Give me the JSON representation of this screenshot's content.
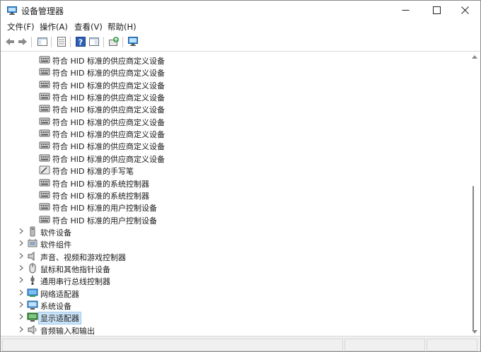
{
  "window": {
    "title": "设备管理器"
  },
  "menu": {
    "items": [
      "文件(F)",
      "操作(A)",
      "查看(V)",
      "帮助(H)"
    ]
  },
  "tree": {
    "children": [
      "符合 HID 标准的供应商定义设备",
      "符合 HID 标准的供应商定义设备",
      "符合 HID 标准的供应商定义设备",
      "符合 HID 标准的供应商定义设备",
      "符合 HID 标准的供应商定义设备",
      "符合 HID 标准的供应商定义设备",
      "符合 HID 标准的供应商定义设备",
      "符合 HID 标准的供应商定义设备",
      "符合 HID 标准的供应商定义设备",
      "符合 HID 标准的手写笔",
      "符合 HID 标准的系统控制器",
      "符合 HID 标准的系统控制器",
      "符合 HID 标准的用户控制设备",
      "符合 HID 标准的用户控制设备"
    ],
    "categories": [
      "软件设备",
      "软件组件",
      "声音、视频和游戏控制器",
      "鼠标和其他指针设备",
      "通用串行总线控制器",
      "网络适配器",
      "系统设备",
      "显示适配器",
      "音频输入和输出"
    ]
  },
  "icons": {
    "child": "hid-device-icon",
    "pen": "pen-device-icon"
  }
}
